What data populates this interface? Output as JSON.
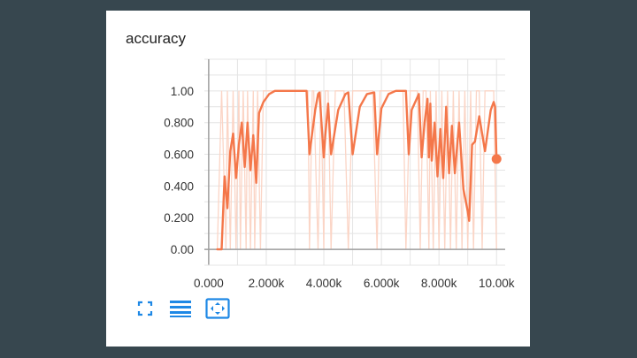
{
  "card": {
    "title": "accuracy"
  },
  "toolbar": {
    "buttons": [
      {
        "icon": "fullscreen-icon"
      },
      {
        "icon": "list-icon"
      },
      {
        "icon": "fit-domain-icon"
      }
    ]
  },
  "colors": {
    "background": "#37474f",
    "series": "#f4774a",
    "series_raw": "#fbd5c6",
    "axis": "#9e9e9e",
    "grid": "#e4e4e4",
    "tool_icon": "#1e88e5"
  },
  "chart_data": {
    "type": "line",
    "title": "accuracy",
    "xlabel": "",
    "ylabel": "",
    "xlim": [
      -150,
      10300
    ],
    "ylim": [
      -0.1,
      1.2
    ],
    "grid": true,
    "x_tick_labels": [
      "0.000",
      "2.000k",
      "4.000k",
      "6.000k",
      "8.000k",
      "10.00k"
    ],
    "x_ticks": [
      0,
      2000,
      4000,
      6000,
      8000,
      10000
    ],
    "y_tick_labels": [
      "0.00",
      "0.200",
      "0.400",
      "0.600",
      "0.800",
      "1.00"
    ],
    "y_ticks": [
      0,
      0.2,
      0.4,
      0.6,
      0.8,
      1.0
    ],
    "series": [
      {
        "kind": "smoothed",
        "x": [
          300,
          450,
          550,
          650,
          750,
          850,
          950,
          1050,
          1150,
          1250,
          1350,
          1450,
          1550,
          1650,
          1750,
          1900,
          2100,
          2300,
          2600,
          2900,
          3200,
          3400,
          3500,
          3700,
          3800,
          3850,
          4000,
          4050,
          4150,
          4250,
          4500,
          4750,
          4850,
          5000,
          5250,
          5500,
          5750,
          5850,
          6000,
          6250,
          6500,
          6850,
          6950,
          7050,
          7300,
          7400,
          7500,
          7600,
          7650,
          7700,
          7750,
          7850,
          7950,
          8050,
          8150,
          8250,
          8350,
          8450,
          8550,
          8700,
          8850,
          9000,
          9050,
          9150,
          9250,
          9400,
          9600,
          9800,
          9900,
          9950,
          10000
        ],
        "y": [
          0,
          0,
          0.46,
          0.26,
          0.62,
          0.73,
          0.45,
          0.66,
          0.8,
          0.52,
          0.8,
          0.5,
          0.72,
          0.42,
          0.86,
          0.93,
          0.98,
          1.0,
          1.0,
          1.0,
          1.0,
          1.0,
          0.6,
          0.88,
          0.98,
          0.99,
          0.58,
          0.72,
          0.92,
          0.6,
          0.88,
          0.98,
          0.99,
          0.6,
          0.9,
          0.98,
          0.99,
          0.6,
          0.89,
          0.98,
          1.0,
          1.0,
          0.6,
          0.88,
          0.98,
          0.58,
          0.8,
          0.95,
          0.58,
          0.92,
          0.56,
          0.8,
          0.46,
          0.76,
          0.45,
          0.9,
          0.48,
          0.78,
          0.48,
          0.8,
          0.38,
          0.24,
          0.18,
          0.66,
          0.68,
          0.84,
          0.62,
          0.88,
          0.93,
          0.9,
          0.57
        ]
      },
      {
        "kind": "raw",
        "x": [
          300,
          450,
          600,
          650,
          750,
          850,
          950,
          1050,
          1100,
          1200,
          1300,
          1350,
          1450,
          1550,
          1600,
          1700,
          1800,
          1900,
          2000,
          2100,
          2250,
          2400,
          2550,
          2700,
          2850,
          3000,
          3150,
          3300,
          3450,
          3500,
          3600,
          3650,
          3800,
          3900,
          4000,
          4050,
          4150,
          4250,
          4400,
          4550,
          4700,
          4850,
          5000,
          5100,
          5250,
          5400,
          5550,
          5700,
          5850,
          5950,
          6050,
          6200,
          6300,
          6450,
          6600,
          6750,
          6850,
          7000,
          7100,
          7250,
          7350,
          7450,
          7550,
          7650,
          7700,
          7800,
          7900,
          8000,
          8100,
          8200,
          8300,
          8400,
          8500,
          8600,
          8700,
          8800,
          8900,
          9000,
          9100,
          9200,
          9300,
          9400,
          9500,
          9600,
          9700,
          9800,
          9900,
          10000
        ],
        "y": [
          0,
          1,
          0,
          1,
          0,
          1,
          0,
          1,
          0,
          1,
          0,
          1,
          0,
          1,
          0,
          1,
          0,
          1,
          1,
          1,
          1,
          1,
          1,
          1,
          1,
          1,
          1,
          1,
          1,
          0,
          1,
          1,
          0,
          1,
          0,
          1,
          1,
          0,
          1,
          1,
          1,
          0,
          1,
          1,
          1,
          1,
          1,
          1,
          0,
          1,
          1,
          1,
          1,
          1,
          1,
          1,
          0,
          1,
          1,
          1,
          0,
          1,
          1,
          0,
          1,
          0,
          1,
          0,
          1,
          0,
          1,
          0,
          1,
          0,
          1,
          0,
          1,
          0,
          1,
          0,
          1,
          1,
          0,
          1,
          1,
          1,
          1,
          0
        ]
      }
    ]
  }
}
